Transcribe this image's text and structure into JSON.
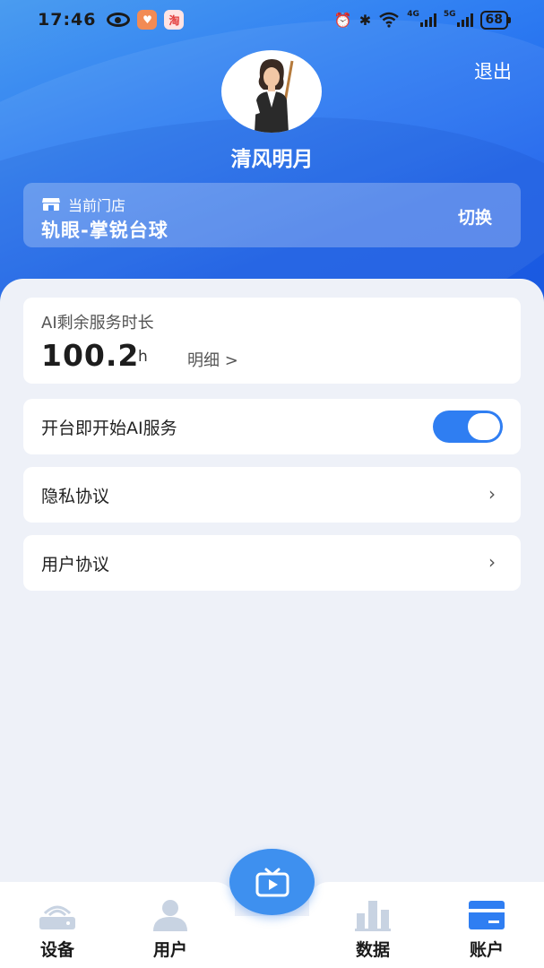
{
  "status_bar": {
    "time": "17:46",
    "network_4g": "4G",
    "network_5g": "5G",
    "battery": "68"
  },
  "header": {
    "logout_label": "退出",
    "username": "清风明月",
    "store_label": "当前门店",
    "store_name": "轨眼-掌锐台球",
    "switch_label": "切换"
  },
  "ai_service": {
    "title": "AI剩余服务时长",
    "value": "100.2",
    "unit": "h",
    "detail_label": "明细 >"
  },
  "settings": {
    "auto_ai_label": "开台即开始AI服务",
    "auto_ai_enabled": true,
    "privacy_label": "隐私协议",
    "user_agreement_label": "用户协议"
  },
  "bottom_nav": {
    "items": [
      {
        "label": "设备",
        "icon": "router-icon"
      },
      {
        "label": "用户",
        "icon": "user-icon"
      },
      {
        "label": "数据",
        "icon": "bar-chart-icon"
      },
      {
        "label": "账户",
        "icon": "card-icon"
      }
    ],
    "center_icon": "tv-icon"
  },
  "colors": {
    "accent": "#2f7ef2",
    "hero_start": "#4a9cf0",
    "hero_end": "#1d5fe8",
    "nav_inactive": "#c8d3e2",
    "nav_active": "#2f7ef2"
  }
}
